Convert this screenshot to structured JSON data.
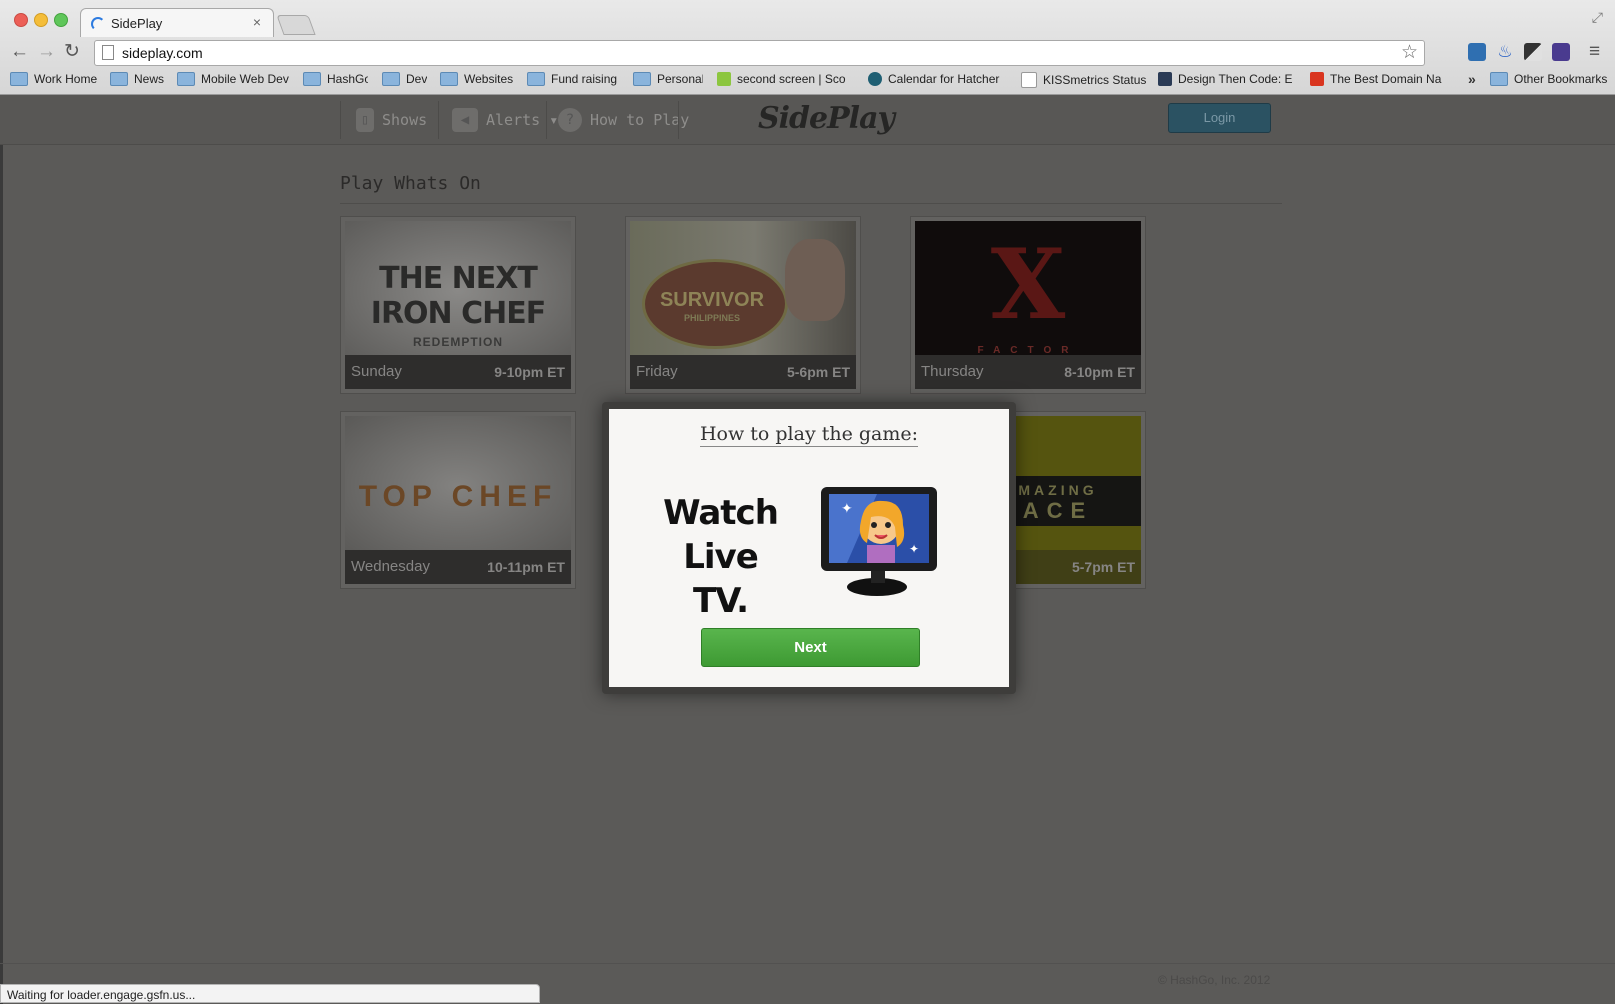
{
  "browser": {
    "tab_title": "SidePlay",
    "tab_close": "×",
    "url": "sideplay.com",
    "bookmarks": [
      {
        "label": "Work Home",
        "type": "folder"
      },
      {
        "label": "News",
        "type": "folder"
      },
      {
        "label": "Mobile Web Dev",
        "type": "folder"
      },
      {
        "label": "HashGo",
        "type": "folder"
      },
      {
        "label": "Dev",
        "type": "folder"
      },
      {
        "label": "Websites",
        "type": "folder"
      },
      {
        "label": "Fund raising",
        "type": "folder"
      },
      {
        "label": "Personal",
        "type": "folder"
      },
      {
        "label": "second screen | Sco",
        "type": "link",
        "icon_color": "#8cc63f"
      },
      {
        "label": "Calendar for Hatcher",
        "type": "link",
        "icon_color": "#1f5f73"
      },
      {
        "label": "KISSmetrics Status",
        "type": "link",
        "icon_color": "#ffffff"
      },
      {
        "label": "Design Then Code: E",
        "type": "link",
        "icon_color": "#2a3a55"
      },
      {
        "label": "The Best Domain Na",
        "type": "link",
        "icon_color": "#d9351f"
      }
    ],
    "more_bookmarks": "»",
    "other_bookmarks": "Other Bookmarks",
    "status_text": "Waiting for loader.engage.gsfn.us..."
  },
  "nav": {
    "shows": "Shows",
    "alerts": "Alerts ▾",
    "how_to_play": "How to Play",
    "logo": "SidePlay",
    "login": "Login"
  },
  "main": {
    "section_title": "Play Whats On",
    "shows": [
      {
        "day": "Sunday",
        "time": "9-10pm ET",
        "art": "THE NEXT IRON CHEF",
        "subtitle": "REDEMPTION"
      },
      {
        "day": "Friday",
        "time": "5-6pm ET",
        "art": "SURVIVOR",
        "subtitle": "PHILIPPINES"
      },
      {
        "day": "Thursday",
        "time": "8-10pm ET",
        "art": "X",
        "subtitle": "FACTOR"
      },
      {
        "day": "Wednesday",
        "time": "10-11pm ET",
        "art": "TOP CHEF",
        "subtitle": ""
      },
      {
        "day": "",
        "time": "5-7pm ET",
        "art": "MAZING",
        "subtitle": "ACE"
      }
    ]
  },
  "modal": {
    "title": "How to play the game:",
    "line1": "Watch",
    "line2": "Live TV.",
    "next": "Next"
  },
  "footer": {
    "copyright": "© HashGo, Inc. 2012"
  },
  "colors": {
    "accent_green": "#4aa83e",
    "login_blue": "#2b5262",
    "overlay": "#5b5a58"
  }
}
